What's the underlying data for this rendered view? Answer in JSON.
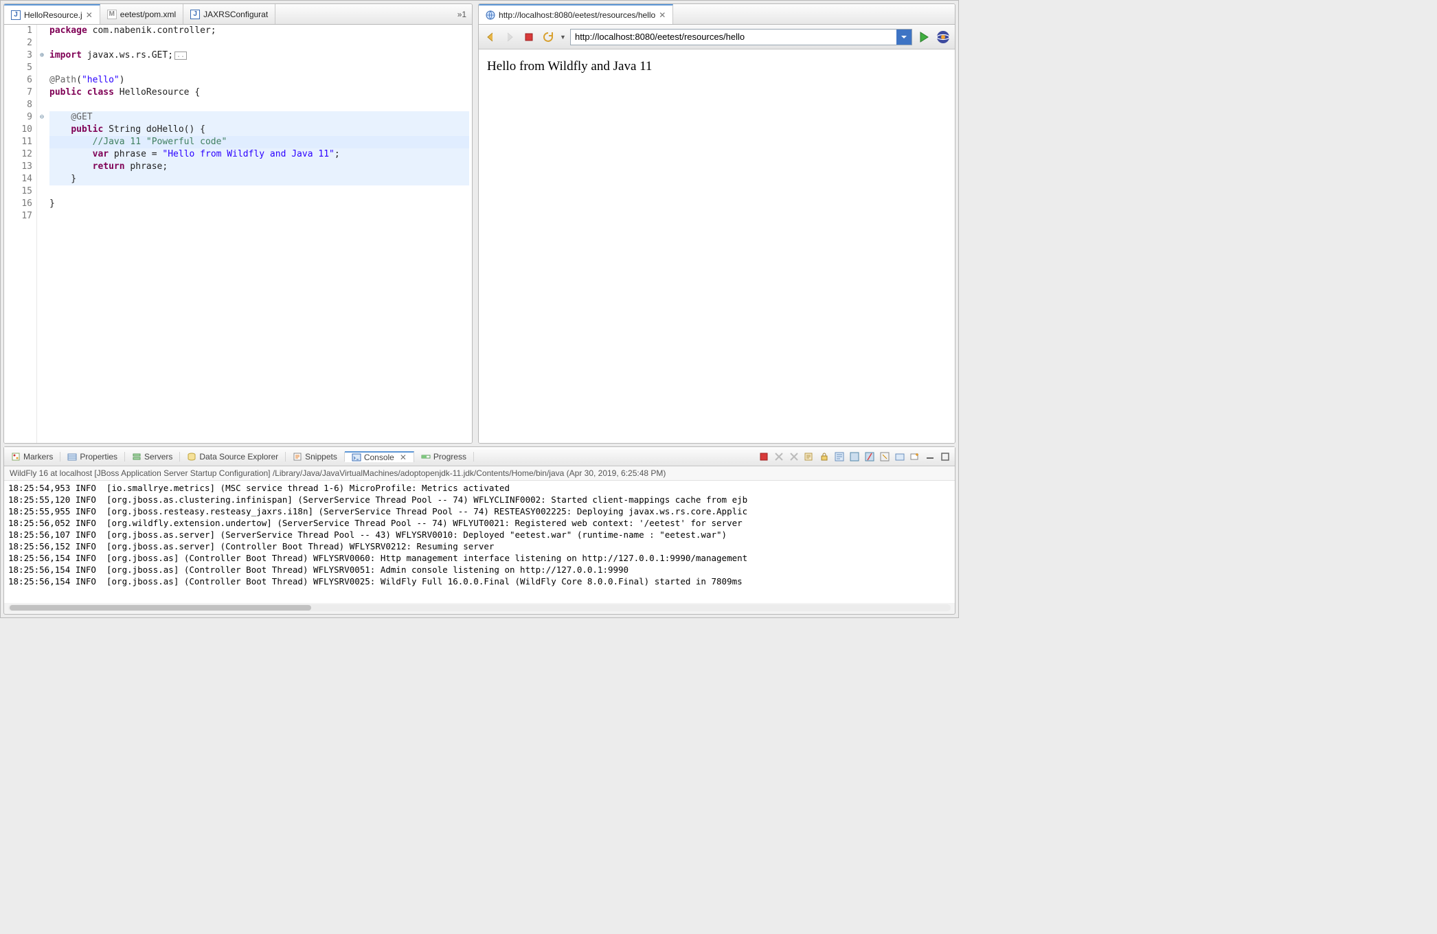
{
  "editor": {
    "tabs": [
      {
        "icon": "java",
        "label": "HelloResource.j",
        "active": true,
        "closable": true
      },
      {
        "icon": "xml",
        "label": "eetest/pom.xml",
        "active": false,
        "closable": false
      },
      {
        "icon": "java",
        "label": "JAXRSConfigurat",
        "active": false,
        "closable": false
      }
    ],
    "overflow_indicator": "»1",
    "code": {
      "lines": [
        {
          "n": 1,
          "fold": "",
          "hl": false,
          "frags": [
            {
              "t": "package ",
              "c": "kw"
            },
            {
              "t": "com.nabenik.controller;"
            }
          ]
        },
        {
          "n": 2,
          "fold": "",
          "hl": false,
          "frags": [
            {
              "t": ""
            }
          ]
        },
        {
          "n": 3,
          "fold": "plus",
          "hl": false,
          "frags": [
            {
              "t": "import ",
              "c": "kw"
            },
            {
              "t": "javax.ws.rs.GET;"
            },
            {
              "t": "[.]",
              "c": "fold"
            }
          ]
        },
        {
          "n": 5,
          "fold": "",
          "hl": false,
          "frags": [
            {
              "t": ""
            }
          ]
        },
        {
          "n": 6,
          "fold": "",
          "hl": false,
          "frags": [
            {
              "t": "@Path",
              "c": "ann"
            },
            {
              "t": "("
            },
            {
              "t": "\"hello\"",
              "c": "str"
            },
            {
              "t": ")"
            }
          ]
        },
        {
          "n": 7,
          "fold": "",
          "hl": false,
          "frags": [
            {
              "t": "public class ",
              "c": "kw"
            },
            {
              "t": "HelloResource {"
            }
          ]
        },
        {
          "n": 8,
          "fold": "",
          "hl": false,
          "frags": [
            {
              "t": ""
            }
          ]
        },
        {
          "n": 9,
          "fold": "minus",
          "hl": true,
          "frags": [
            {
              "t": "    @GET",
              "c": "ann"
            }
          ]
        },
        {
          "n": 10,
          "fold": "",
          "hl": true,
          "frags": [
            {
              "t": "    "
            },
            {
              "t": "public ",
              "c": "kw"
            },
            {
              "t": "String doHello() {"
            }
          ]
        },
        {
          "n": 11,
          "fold": "",
          "hl": true,
          "cur": true,
          "frags": [
            {
              "t": "        "
            },
            {
              "t": "//Java 11 \"Powerful code\"",
              "c": "cm"
            }
          ]
        },
        {
          "n": 12,
          "fold": "",
          "hl": true,
          "frags": [
            {
              "t": "        "
            },
            {
              "t": "var",
              "c": "kw"
            },
            {
              "t": " phrase = "
            },
            {
              "t": "\"Hello from Wildfly and Java 11\"",
              "c": "str"
            },
            {
              "t": ";"
            }
          ]
        },
        {
          "n": 13,
          "fold": "",
          "hl": true,
          "frags": [
            {
              "t": "        "
            },
            {
              "t": "return ",
              "c": "kw"
            },
            {
              "t": "phrase;"
            }
          ]
        },
        {
          "n": 14,
          "fold": "",
          "hl": true,
          "frags": [
            {
              "t": "    }"
            }
          ]
        },
        {
          "n": 15,
          "fold": "",
          "hl": false,
          "frags": [
            {
              "t": ""
            }
          ]
        },
        {
          "n": 16,
          "fold": "",
          "hl": false,
          "frags": [
            {
              "t": "}"
            }
          ]
        },
        {
          "n": 17,
          "fold": "",
          "hl": false,
          "frags": [
            {
              "t": ""
            }
          ]
        }
      ]
    }
  },
  "browser": {
    "tab_title": "http://localhost:8080/eetest/resources/hello",
    "url": "http://localhost:8080/eetest/resources/hello",
    "body_text": "Hello from Wildfly and Java 11"
  },
  "bottom": {
    "views": [
      {
        "icon": "markers",
        "label": "Markers"
      },
      {
        "icon": "properties",
        "label": "Properties"
      },
      {
        "icon": "servers",
        "label": "Servers"
      },
      {
        "icon": "dse",
        "label": "Data Source Explorer"
      },
      {
        "icon": "snippets",
        "label": "Snippets"
      },
      {
        "icon": "console",
        "label": "Console",
        "active": true,
        "closable": true
      },
      {
        "icon": "progress",
        "label": "Progress"
      }
    ],
    "console_header": "WildFly 16 at localhost [JBoss Application Server Startup Configuration] /Library/Java/JavaVirtualMachines/adoptopenjdk-11.jdk/Contents/Home/bin/java (Apr 30, 2019, 6:25:48 PM)",
    "console_lines": [
      "18:25:54,953 INFO  [io.smallrye.metrics] (MSC service thread 1-6) MicroProfile: Metrics activated",
      "18:25:55,120 INFO  [org.jboss.as.clustering.infinispan] (ServerService Thread Pool -- 74) WFLYCLINF0002: Started client-mappings cache from ejb",
      "18:25:55,955 INFO  [org.jboss.resteasy.resteasy_jaxrs.i18n] (ServerService Thread Pool -- 74) RESTEASY002225: Deploying javax.ws.rs.core.Applic",
      "18:25:56,052 INFO  [org.wildfly.extension.undertow] (ServerService Thread Pool -- 74) WFLYUT0021: Registered web context: '/eetest' for server",
      "18:25:56,107 INFO  [org.jboss.as.server] (ServerService Thread Pool -- 43) WFLYSRV0010: Deployed \"eetest.war\" (runtime-name : \"eetest.war\")",
      "18:25:56,152 INFO  [org.jboss.as.server] (Controller Boot Thread) WFLYSRV0212: Resuming server",
      "18:25:56,154 INFO  [org.jboss.as] (Controller Boot Thread) WFLYSRV0060: Http management interface listening on http://127.0.0.1:9990/management",
      "18:25:56,154 INFO  [org.jboss.as] (Controller Boot Thread) WFLYSRV0051: Admin console listening on http://127.0.0.1:9990",
      "18:25:56,154 INFO  [org.jboss.as] (Controller Boot Thread) WFLYSRV0025: WildFly Full 16.0.0.Final (WildFly Core 8.0.0.Final) started in 7809ms"
    ]
  }
}
